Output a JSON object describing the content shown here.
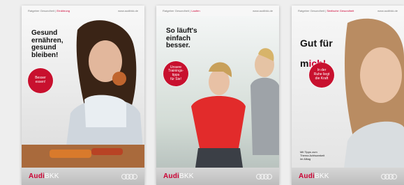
{
  "brochures": [
    {
      "topbar": {
        "category_prefix": "Ratgeber Gesundheit |",
        "category": "Ernährung",
        "url": "www.audibkk.de"
      },
      "headline": "Gesund\nernähren,\ngesund\nbleiben!",
      "badge": "Besser\nessen!",
      "brand": {
        "audi": "Audi",
        "bkk": "BKK"
      }
    },
    {
      "topbar": {
        "category_prefix": "Ratgeber Gesundheit |",
        "category": "Laufen",
        "url": "www.audibkk.de"
      },
      "headline": "So läuft's\neinfach\nbesser.",
      "badge": "Unsere\nTrainings-\ntipps\nfür Sie!",
      "brand": {
        "audi": "Audi",
        "bkk": "BKK"
      }
    },
    {
      "topbar": {
        "category_prefix": "Ratgeber Gesundheit |",
        "category": "Seelische Gesundheit",
        "url": "www.audibkk.de"
      },
      "headline_line1": "Gut für",
      "headline_line2_black": "m",
      "headline_line2_red": "ich!",
      "badge": "In der\nRuhe liegt\ndie Kraft",
      "bottom_text": "Mit Tipps zum\nThema Achtsamkeit\nim Alltag",
      "brand": {
        "audi": "Audi",
        "bkk": "BKK"
      }
    }
  ]
}
